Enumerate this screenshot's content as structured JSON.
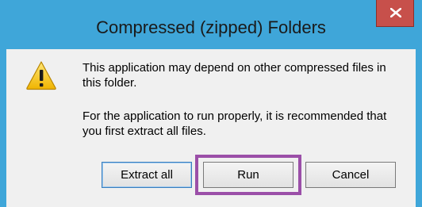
{
  "window": {
    "title": "Compressed (zipped) Folders",
    "close_icon": "close-icon",
    "accent_color": "#3fa6d9",
    "close_color": "#c7504b"
  },
  "dialog": {
    "icon": "warning-icon",
    "message_primary": "This application may depend on other compressed files in this folder.",
    "message_secondary": "For the application to run properly, it is recommended that you first extract all files."
  },
  "buttons": {
    "extract_all": "Extract all",
    "run": "Run",
    "cancel": "Cancel"
  },
  "annotation": {
    "highlight_color": "#9b4fa8",
    "highlighted_button": "run"
  }
}
